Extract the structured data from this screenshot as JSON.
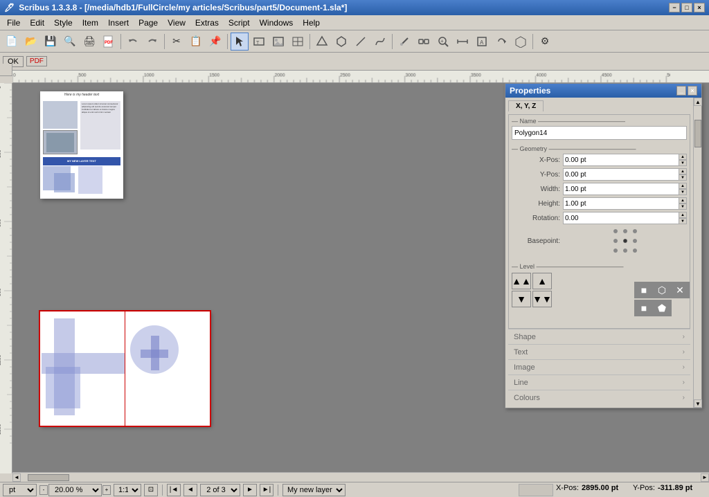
{
  "titlebar": {
    "title": "Scribus 1.3.3.8 - [/media/hdb1/FullCircle/my articles/Scribus/part5/Document-1.sla*]",
    "icon": "scribus-icon",
    "buttons": {
      "minimize": "−",
      "maximize": "□",
      "close": "×"
    }
  },
  "menubar": {
    "items": [
      "File",
      "Edit",
      "Style",
      "Item",
      "Insert",
      "Page",
      "View",
      "Extras",
      "Script",
      "Windows",
      "Help"
    ]
  },
  "toolbar": {
    "buttons": [
      {
        "name": "new-btn",
        "icon": "📄"
      },
      {
        "name": "open-btn",
        "icon": "📂"
      },
      {
        "name": "save-btn",
        "icon": "💾"
      },
      {
        "name": "preflight-btn",
        "icon": "🔍"
      },
      {
        "name": "print-btn",
        "icon": "🖨️"
      },
      {
        "name": "pdf-export-btn",
        "icon": "📕"
      },
      {
        "name": "undo-btn",
        "icon": "↩"
      },
      {
        "name": "redo-btn",
        "icon": "↪"
      },
      {
        "name": "cut-btn",
        "icon": "✂"
      },
      {
        "name": "copy-btn",
        "icon": "📋"
      },
      {
        "name": "paste-btn",
        "icon": "📌"
      },
      {
        "name": "select-btn",
        "icon": "↖",
        "active": true
      },
      {
        "name": "text-btn",
        "icon": "T"
      },
      {
        "name": "image-btn",
        "icon": "🖼"
      },
      {
        "name": "table-btn",
        "icon": "⊞"
      },
      {
        "name": "shape-btn",
        "icon": "△"
      },
      {
        "name": "polygon-btn",
        "icon": "⬡"
      },
      {
        "name": "line-btn",
        "icon": "/"
      },
      {
        "name": "bezier-btn",
        "icon": "∿"
      },
      {
        "name": "eye-dropper-btn",
        "icon": "🔬"
      },
      {
        "name": "link-btn",
        "icon": "🔗"
      },
      {
        "name": "zoom-btn",
        "icon": "🔎"
      },
      {
        "name": "measure-btn",
        "icon": "📏"
      },
      {
        "name": "pdf-annot-btn",
        "icon": "📝"
      },
      {
        "name": "rotate-btn",
        "icon": "↺"
      },
      {
        "name": "3d-btn",
        "icon": "◇"
      },
      {
        "name": "more-btn",
        "icon": "⚙"
      }
    ]
  },
  "toolbar2": {
    "ok_label": "OK",
    "pdf_label": "PDF"
  },
  "properties": {
    "title": "Properties",
    "tabs": {
      "xyz_label": "X, Y, Z"
    },
    "name_label": "Name",
    "name_value": "Polygon14",
    "geometry_label": "Geometry",
    "x_pos_label": "X-Pos:",
    "x_pos_value": "0.00 pt",
    "y_pos_label": "Y-Pos:",
    "y_pos_value": "0.00 pt",
    "width_label": "Width:",
    "width_value": "1.00 pt",
    "height_label": "Height:",
    "height_value": "1.00 pt",
    "rotation_label": "Rotation:",
    "rotation_value": "0.00",
    "basepoint_label": "Basepoint:",
    "level_label": "Level",
    "shape_label": "Shape",
    "text_label": "Text",
    "image_label": "Image",
    "line_label": "Line",
    "colours_label": "Colours"
  },
  "canvas": {
    "background": "#808080",
    "page1": {
      "header_text": "Here is my header text"
    },
    "page2": {
      "has_selection": true
    }
  },
  "statusbar": {
    "unit": "pt",
    "zoom": "20.00 %",
    "ratio": "1:1",
    "page_of": "2 of 3",
    "layer": "My new layer",
    "x_pos_label": "X-Pos:",
    "x_pos_value": "2895.00 pt",
    "y_pos_label": "Y-Pos:",
    "y_pos_value": "-311.89 pt"
  }
}
